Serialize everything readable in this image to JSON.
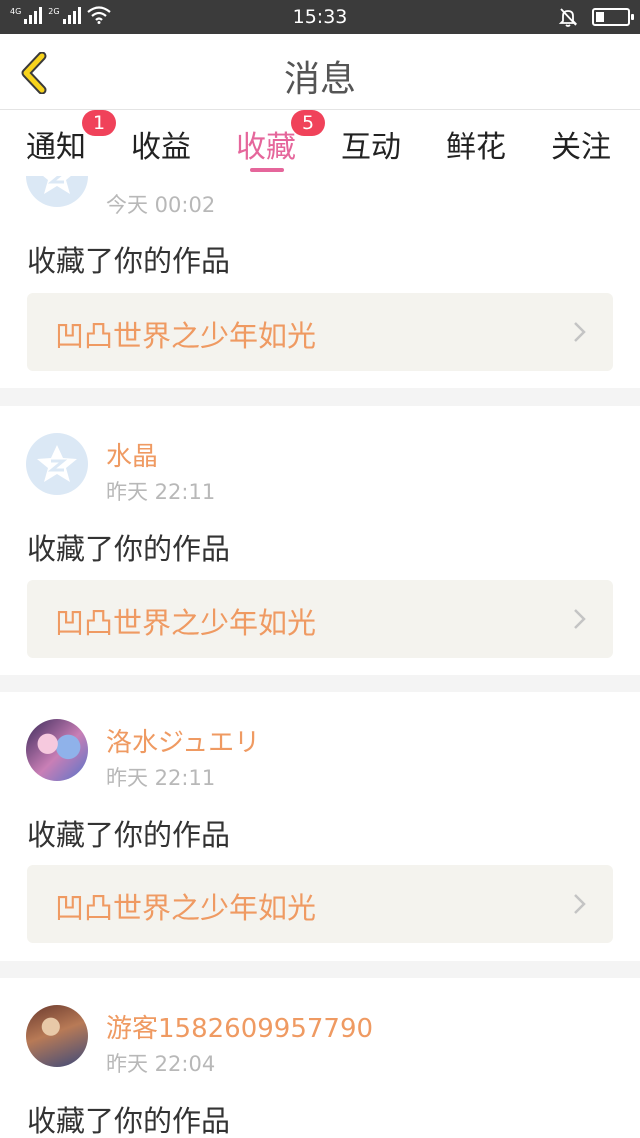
{
  "status_bar": {
    "network_1": "4G",
    "network_2": "2G",
    "time": "15:33",
    "battery_level": 0.25,
    "icons": [
      "signal-icon",
      "wifi-icon",
      "mute-icon",
      "battery-icon"
    ]
  },
  "nav": {
    "title": "消息",
    "back_icon": "chevron-left-icon"
  },
  "tabs": [
    {
      "label": "通知",
      "badge": "1",
      "active": false
    },
    {
      "label": "收益",
      "badge": "",
      "active": false
    },
    {
      "label": "收藏",
      "badge": "5",
      "active": true
    },
    {
      "label": "互动",
      "badge": "",
      "active": false
    },
    {
      "label": "鲜花",
      "badge": "",
      "active": false
    },
    {
      "label": "关注",
      "badge": "",
      "active": false
    }
  ],
  "feed": {
    "items": [
      {
        "user": "",
        "time": "今天 00:02",
        "action": "收藏了你的作品",
        "work_title": "凹凸世界之少年如光",
        "avatar": "qq-default-avatar"
      },
      {
        "user": "水晶",
        "time": "昨天 22:11",
        "action": "收藏了你的作品",
        "work_title": "凹凸世界之少年如光",
        "avatar": "qq-default-avatar"
      },
      {
        "user": "洛水ジュエリ",
        "time": "昨天 22:11",
        "action": "收藏了你的作品",
        "work_title": "凹凸世界之少年如光",
        "avatar": "anime-avatar"
      },
      {
        "user": "游客1582609957790",
        "time": "昨天 22:04",
        "action": "收藏了你的作品",
        "work_title": "",
        "avatar": "anime-avatar"
      }
    ]
  },
  "colors": {
    "accent_pink": "#e5669b",
    "username_orange": "#ef9a62",
    "badge_red": "#f0425a",
    "back_arrow_yellow": "#f7d31c"
  }
}
